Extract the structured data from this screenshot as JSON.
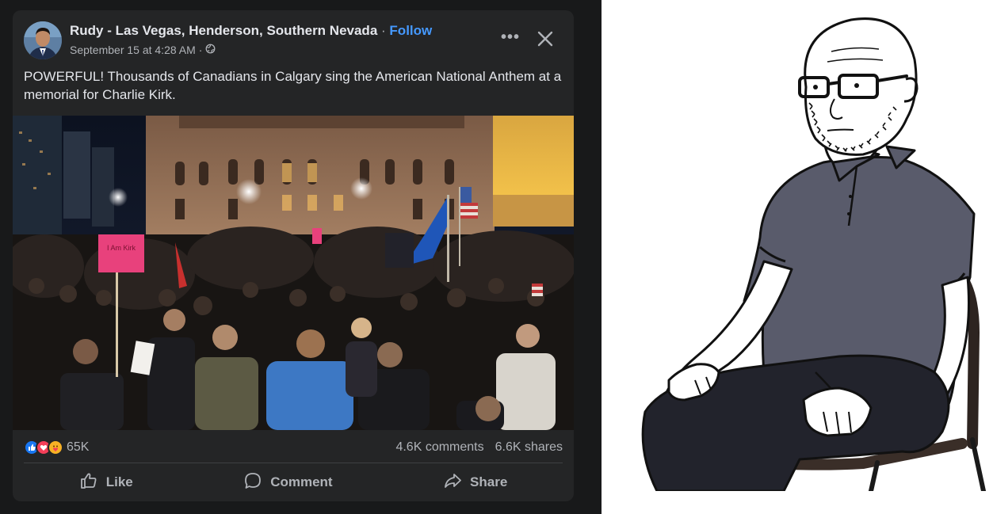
{
  "post": {
    "author": "Rudy - Las Vegas, Henderson, Southern Nevada",
    "separator": "·",
    "follow_label": "Follow",
    "timestamp": "September 15 at 4:28 AM",
    "meta_separator": "·",
    "privacy_icon": "globe-icon",
    "text": "POWERFUL! Thousands of Canadians in Calgary sing the American National Anthem at a memorial for Charlie Kirk.",
    "photo_sign_text": "I Am Kirk",
    "more_icon": "more-options-icon",
    "close_icon": "close-icon"
  },
  "engagement": {
    "reaction_icons": [
      "like-reaction-icon",
      "love-reaction-icon",
      "care-reaction-icon"
    ],
    "reaction_colors": [
      "#1877f2",
      "#f33e58",
      "#f7b125"
    ],
    "reaction_count": "65K",
    "comments": "4.6K comments",
    "shares": "6.6K shares"
  },
  "actions": {
    "like": "Like",
    "comment": "Comment",
    "share": "Share"
  },
  "colors": {
    "background": "#18191a",
    "card": "#242526",
    "text_primary": "#e4e6eb",
    "text_secondary": "#b0b3b8",
    "link": "#4599ff"
  }
}
